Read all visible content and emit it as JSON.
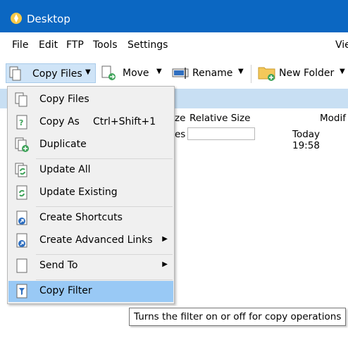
{
  "window": {
    "title": "Desktop"
  },
  "menubar": {
    "items": [
      "File",
      "Edit",
      "FTP",
      "Tools",
      "Settings",
      "Vie"
    ]
  },
  "toolbar": {
    "copy_files": "Copy Files",
    "move": "Move",
    "rename": "Rename",
    "new_folder": "New Folder"
  },
  "filelist": {
    "col_size_partial": "ze",
    "col_relative_size": "Relative Size",
    "col_modified_partial": "Modif",
    "row1_type_partial": "es",
    "row1_modified": "Today  19:58"
  },
  "dropdown": {
    "items": [
      {
        "label": "Copy Files",
        "icon": "copy-files-icon"
      },
      {
        "label": "Copy As",
        "shortcut": "Ctrl+Shift+1",
        "icon": "copy-as-icon"
      },
      {
        "label": "Duplicate",
        "icon": "duplicate-icon"
      },
      {
        "label": "Update All",
        "icon": "update-all-icon"
      },
      {
        "label": "Update Existing",
        "icon": "update-existing-icon"
      },
      {
        "label": "Create Shortcuts",
        "icon": "shortcut-icon"
      },
      {
        "label": "Create Advanced Links",
        "icon": "advanced-link-icon"
      },
      {
        "label": "Send To",
        "icon": "send-to-icon"
      },
      {
        "label": "Copy Filter",
        "icon": "filter-icon"
      }
    ]
  },
  "tooltip": {
    "text": "Turns the filter on or off for copy operations"
  },
  "colors": {
    "titlebar": "#0b67c2",
    "highlight": "#99c9f5",
    "pathbar": "#c8dff3"
  }
}
